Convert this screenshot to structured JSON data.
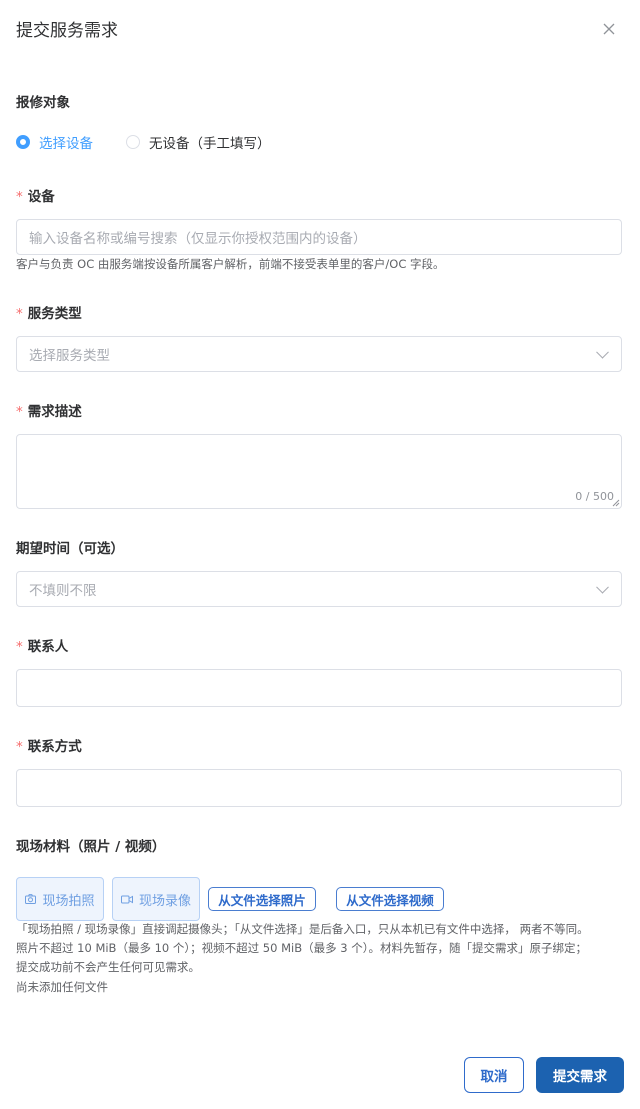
{
  "dialog": {
    "title": "提交服务需求"
  },
  "repair_target": {
    "label": "报修对象",
    "options": [
      {
        "label": "选择设备",
        "selected": true
      },
      {
        "label": "无设备（手工填写）",
        "selected": false
      }
    ]
  },
  "device": {
    "label": "设备",
    "placeholder": "输入设备名称或编号搜索（仅显示你授权范围内的设备）",
    "hint": "客户与负责 OC 由服务端按设备所属客户解析，前端不接受表单里的客户/OC 字段。"
  },
  "service_type": {
    "label": "服务类型",
    "placeholder": "选择服务类型"
  },
  "description": {
    "label": "需求描述",
    "counter": "0 / 500"
  },
  "expected_time": {
    "label": "期望时间（可选）",
    "placeholder": "不填则不限"
  },
  "contact": {
    "label": "联系人"
  },
  "contact_method": {
    "label": "联系方式"
  },
  "materials": {
    "label": "现场材料（照片 / 视频）",
    "take_photo": "现场拍照",
    "record_video": "现场录像",
    "choose_photo": "从文件选择照片",
    "choose_video": "从文件选择视频",
    "hint_line1": "「现场拍照 / 现场录像」直接调起摄像头；「从文件选择」是后备入口，只从本机已有文件中选择， 两者不等同。",
    "hint_line2": "照片不超过 10 MiB（最多 10 个）；视频不超过 50 MiB（最多 3 个）。材料先暂存，随「提交需求」原子绑定；",
    "hint_line3": "提交成功前不会产生任何可见需求。",
    "empty_text": "尚未添加任何文件"
  },
  "footer": {
    "cancel": "取消",
    "submit": "提交需求"
  },
  "colors": {
    "primary": "#409eff",
    "submit_bg": "#1c62b0",
    "required": "#f56c6c"
  }
}
